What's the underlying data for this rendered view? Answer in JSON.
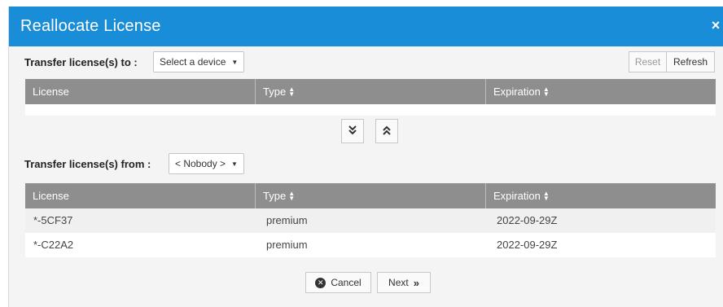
{
  "dialog": {
    "title": "Reallocate License",
    "close_glyph": "×"
  },
  "transfer_to": {
    "label": "Transfer license(s) to :",
    "selected": "Select a device",
    "reset_label": "Reset",
    "refresh_label": "Refresh"
  },
  "table_to": {
    "columns": [
      "License",
      "Type",
      "Expiration"
    ],
    "rows": []
  },
  "move_buttons": {
    "move_down_icon": "double-chevron-down-icon",
    "move_up_icon": "double-chevron-up-icon"
  },
  "transfer_from": {
    "label": "Transfer license(s) from :",
    "selected": "< Nobody >"
  },
  "table_from": {
    "columns": [
      "License",
      "Type",
      "Expiration"
    ],
    "rows": [
      {
        "license": "*-5CF37",
        "type": "premium",
        "expiration": "2022-09-29Z"
      },
      {
        "license": "*-C22A2",
        "type": "premium",
        "expiration": "2022-09-29Z"
      }
    ]
  },
  "footer": {
    "cancel_label": "Cancel",
    "next_label": "Next"
  },
  "colors": {
    "titlebar": "#1a8dd8",
    "table_header": "#8e8e8e",
    "dialog_bg": "#f4f4f4"
  }
}
